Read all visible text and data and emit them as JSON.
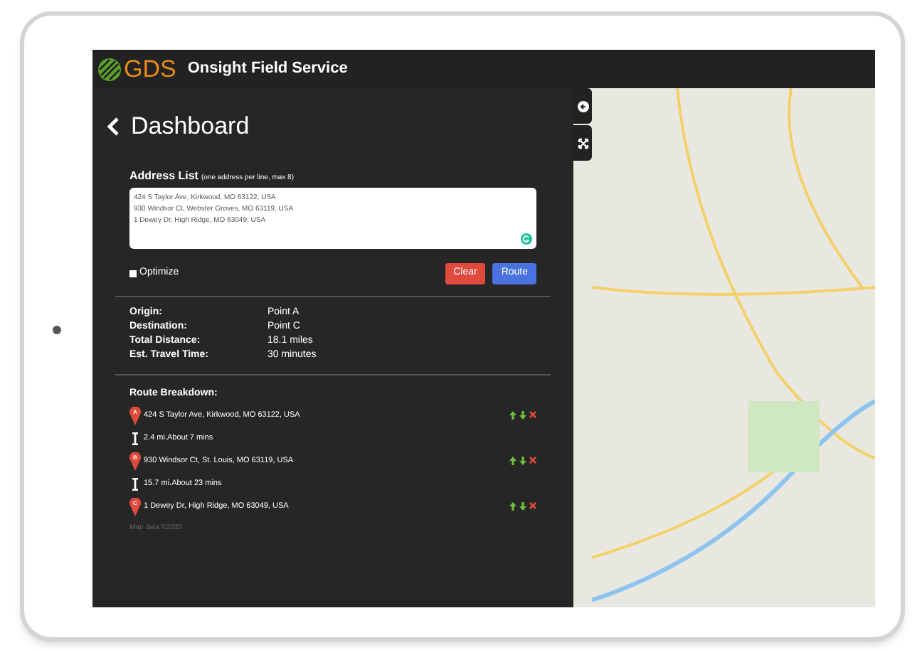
{
  "header": {
    "logo": "GDS",
    "title": "Onsight Field Service"
  },
  "panel": {
    "title": "Dashboard",
    "address_list": {
      "label": "Address List",
      "hint": "(one address per line, max 8)",
      "value": "424 S Taylor Ave, Kirkwood, MO 63122, USA\n930 Windsor Ct, Webster Groves, MO 63119, USA\n1 Dewey Dr, High Ridge, MO 63049, USA"
    },
    "optimize": {
      "label": "Optimize",
      "checked": false
    },
    "buttons": [
      {
        "label": "Clear",
        "kind": "danger"
      },
      {
        "label": "Route",
        "kind": "primary"
      }
    ],
    "summary": [
      {
        "label": "Origin:",
        "value": "Point A"
      },
      {
        "label": "Destination:",
        "value": "Point C"
      },
      {
        "label": "Total Distance:",
        "value": "18.1 miles"
      },
      {
        "label": "Est. Travel Time:",
        "value": "30 minutes"
      }
    ],
    "breakdown_title": "Route Breakdown:",
    "breakdown": [
      {
        "kind": "stop",
        "marker": "A",
        "text": "424 S Taylor Ave, Kirkwood, MO 63122, USA"
      },
      {
        "kind": "leg",
        "text": "2.4 mi.About 7 mins"
      },
      {
        "kind": "stop",
        "marker": "B",
        "text": "930 Windsor Ct, St. Louis, MO 63119, USA"
      },
      {
        "kind": "leg",
        "text": "15.7 mi.About 23 mins"
      },
      {
        "kind": "stop",
        "marker": "C",
        "text": "1 Dewey Dr, High Ridge, MO 63049, USA"
      }
    ],
    "map_credit": "Map data ©2020"
  }
}
